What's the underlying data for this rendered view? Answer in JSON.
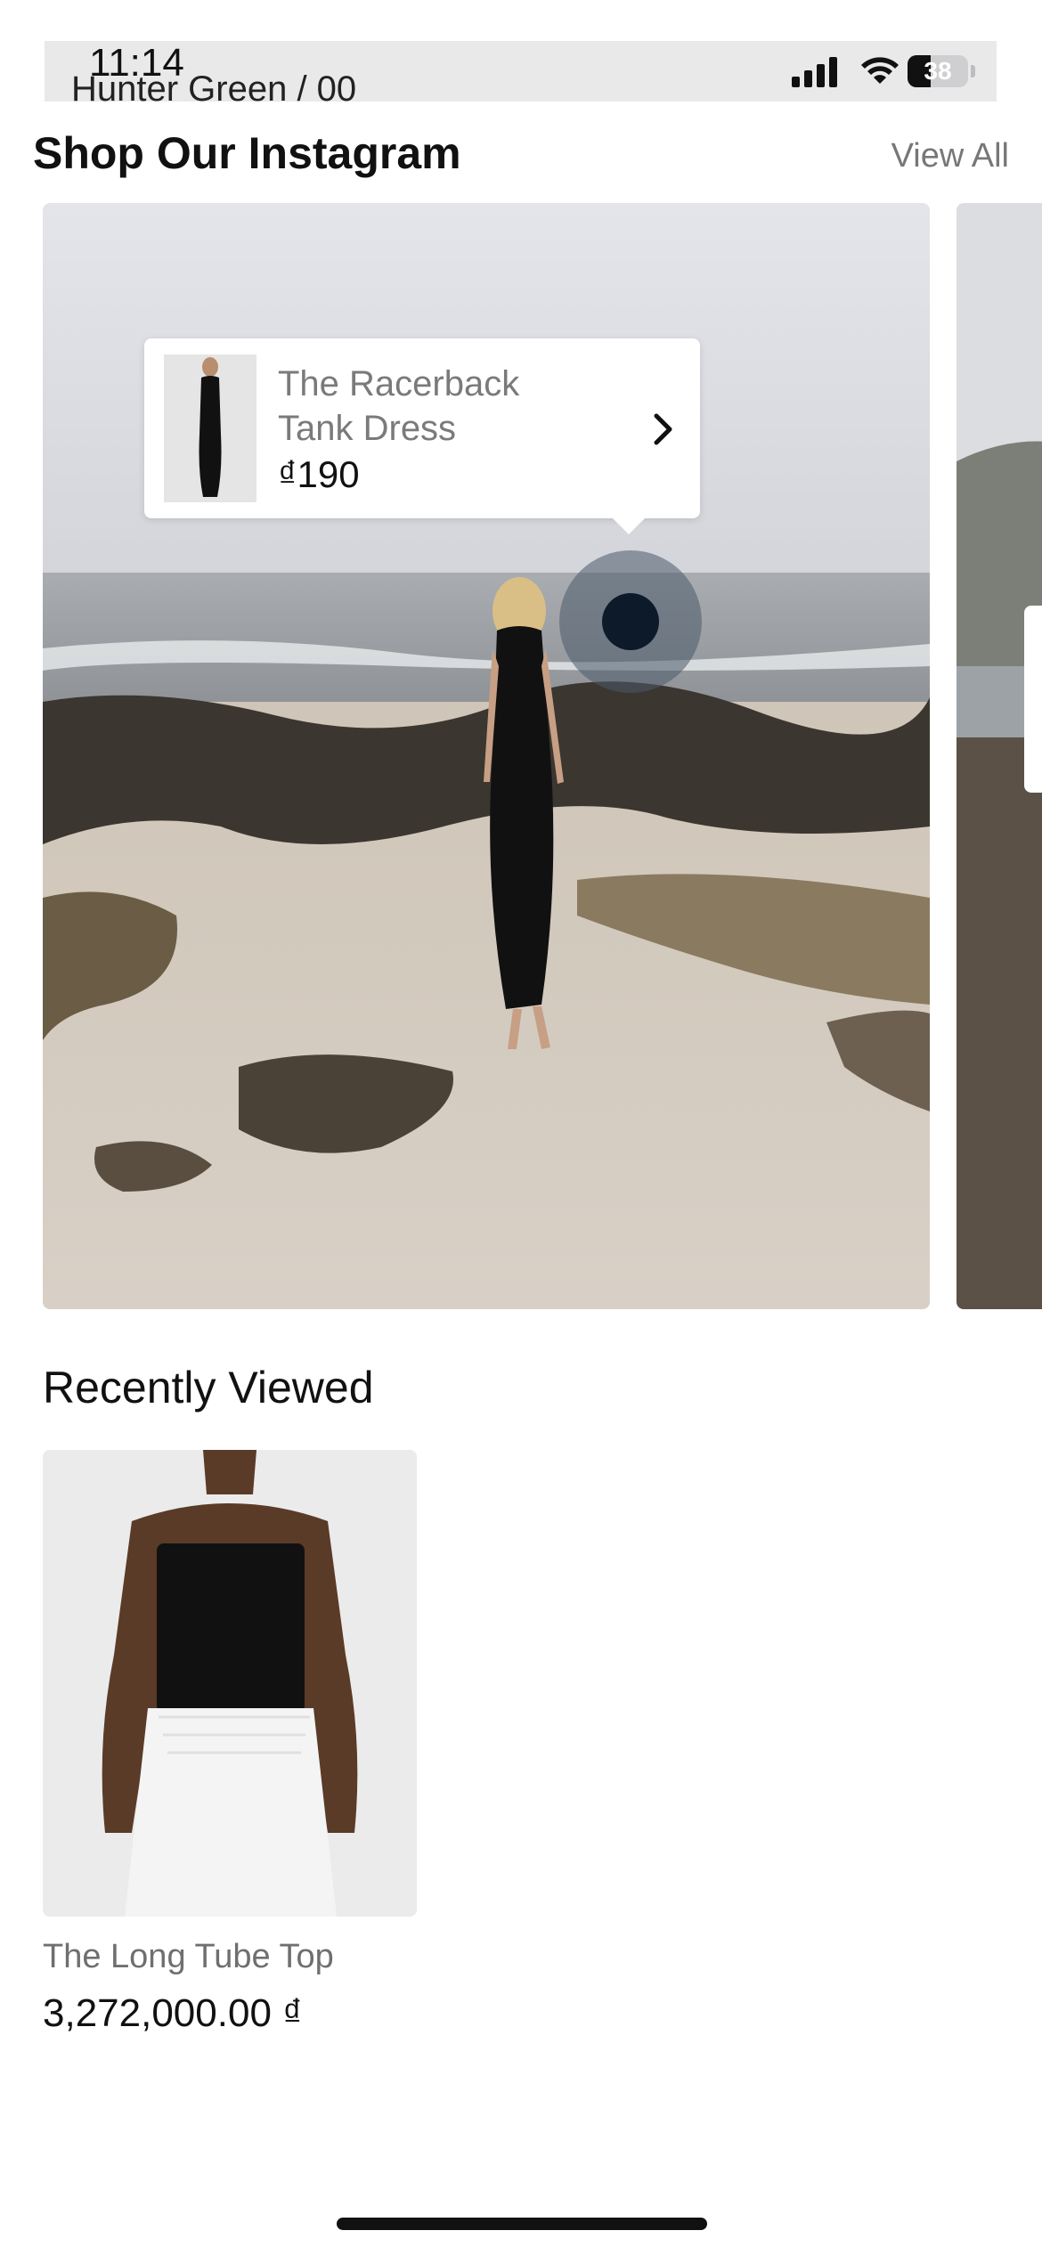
{
  "status_bar": {
    "time": "11:14",
    "battery": "38",
    "peek_title": "Hunter Green / 00"
  },
  "instagram": {
    "title": "Shop Our Instagram",
    "view_all": "View All",
    "product": {
      "name": "The Racerback Tank Dress",
      "price": "₫190"
    }
  },
  "recently_viewed": {
    "title": "Recently Viewed",
    "items": [
      {
        "name": "The Long Tube Top",
        "price": "3,272,000.00 ₫"
      }
    ]
  },
  "icons": [
    "signal-icon",
    "wifi-icon",
    "battery-icon",
    "chevron-right-icon"
  ],
  "colors": {
    "status_bar_bg": "#e9e9ea",
    "muted_text": "#777777",
    "hotspot_dot": "#0c1a2a"
  }
}
